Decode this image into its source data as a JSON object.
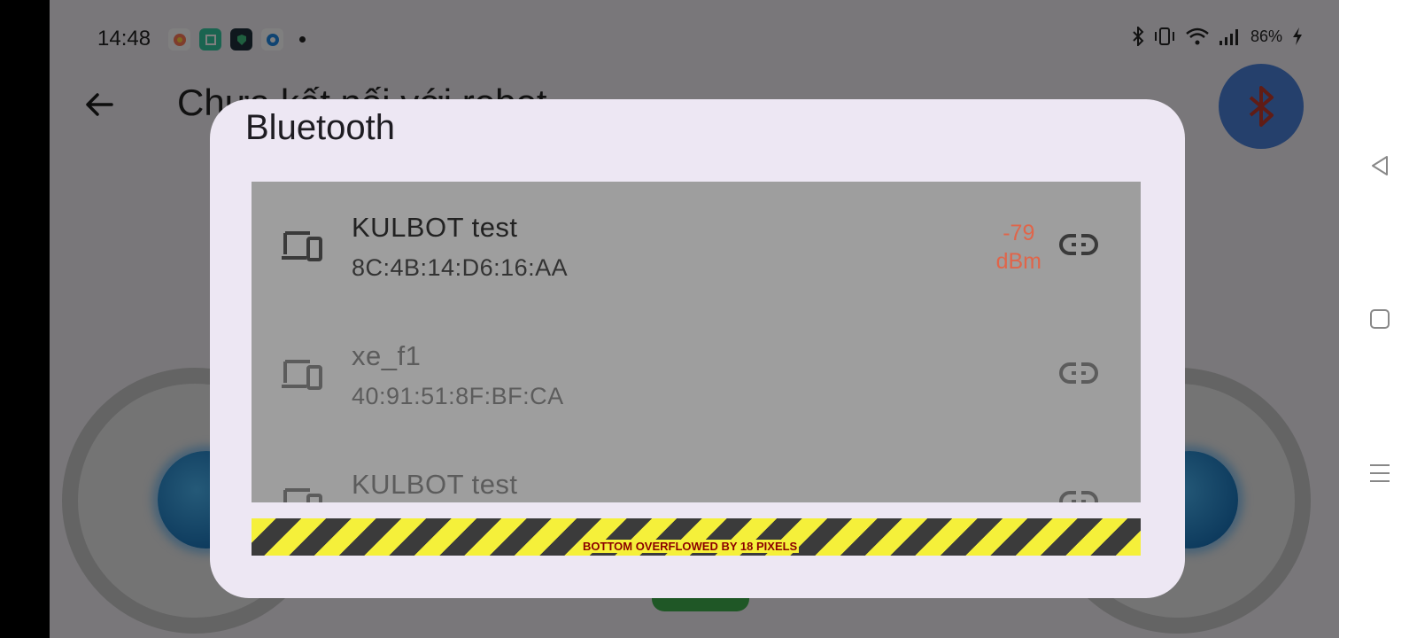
{
  "status_bar": {
    "time": "14:48",
    "battery": "86%",
    "app_icons": [
      "star-app-icon",
      "calendar-app-icon",
      "shield-app-icon",
      "browser-app-icon"
    ]
  },
  "app_bar": {
    "title": "Chưa kết nối với robot"
  },
  "dialog": {
    "title": "Bluetooth",
    "devices": [
      {
        "name": "KULBOT test",
        "address": "8C:4B:14:D6:16:AA",
        "rssi_value": "-79",
        "rssi_unit": "dBm"
      },
      {
        "name": "xe_f1",
        "address": "40:91:51:8F:BF:CA"
      },
      {
        "name": "KULBOT test",
        "address": ""
      }
    ],
    "overflow_message": "BOTTOM OVERFLOWED BY 18 PIXELS"
  },
  "colors": {
    "dialog_bg": "#ede7f3",
    "list_bg": "#9e9e9e",
    "rssi": "#e0654a",
    "fab": "#4b80d9",
    "bt_icon": "#c0392b"
  }
}
